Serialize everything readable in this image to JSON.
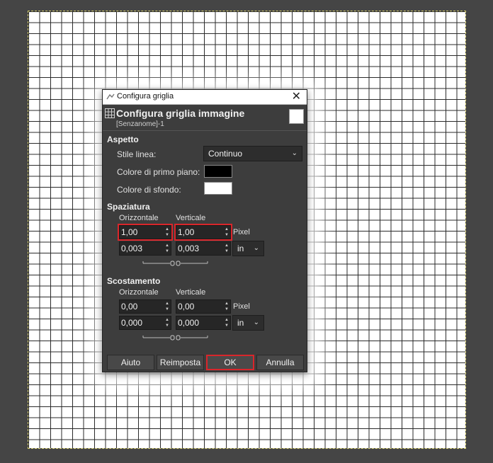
{
  "window": {
    "title": "Configura griglia"
  },
  "header": {
    "title": "Configura griglia immagine",
    "subtitle": "[Senzanome]-1"
  },
  "appearance": {
    "section": "Aspetto",
    "line_style_label": "Stile linea:",
    "line_style_value": "Continuo",
    "fg_color_label": "Colore di primo piano:",
    "fg_color": "#000000",
    "bg_color_label": "Colore di sfondo:",
    "bg_color": "#ffffff"
  },
  "spacing": {
    "section": "Spaziatura",
    "horizontal_label": "Orizzontale",
    "vertical_label": "Verticale",
    "h_pixels": "1,00",
    "v_pixels": "1,00",
    "pixel_unit": "Pixel",
    "h_inches": "0,003",
    "v_inches": "0,003",
    "unit": "in"
  },
  "offset": {
    "section": "Scostamento",
    "horizontal_label": "Orizzontale",
    "vertical_label": "Verticale",
    "h_pixels": "0,00",
    "v_pixels": "0,00",
    "pixel_unit": "Pixel",
    "h_inches": "0,000",
    "v_inches": "0,000",
    "unit": "in"
  },
  "buttons": {
    "help": "Aiuto",
    "reset": "Reimposta",
    "ok": "OK",
    "cancel": "Annulla"
  },
  "colors": {
    "highlight": "#d9262b",
    "dialog_bg": "#3d3d3d",
    "workspace": "#454545"
  }
}
